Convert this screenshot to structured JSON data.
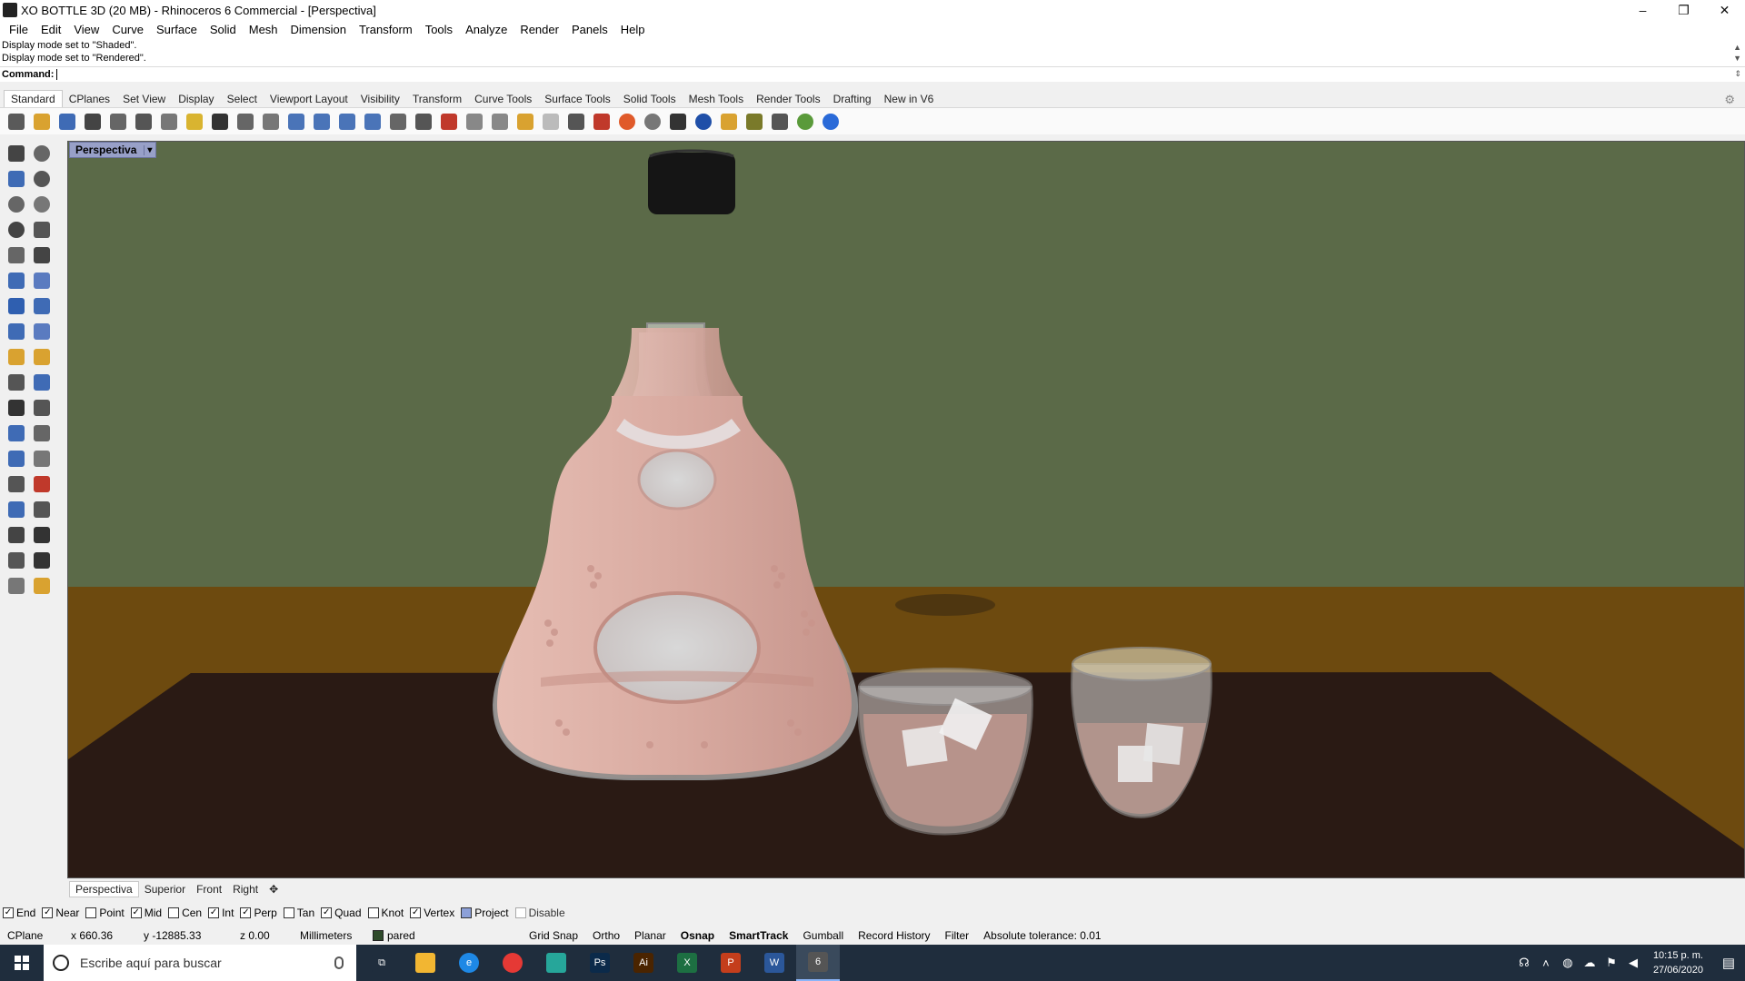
{
  "window": {
    "title": "XO BOTTLE 3D (20 MB) - Rhinoceros 6 Commercial - [Perspectiva]",
    "minimize": "–",
    "restore": "❐",
    "close": "✕"
  },
  "menu": [
    "File",
    "Edit",
    "View",
    "Curve",
    "Surface",
    "Solid",
    "Mesh",
    "Dimension",
    "Transform",
    "Tools",
    "Analyze",
    "Render",
    "Panels",
    "Help"
  ],
  "command_history": [
    "Display mode set to \"Shaded\".",
    "Display mode set to \"Rendered\"."
  ],
  "command_prompt": "Command:",
  "toolbar_tabs": [
    "Standard",
    "CPlanes",
    "Set View",
    "Display",
    "Select",
    "Viewport Layout",
    "Visibility",
    "Transform",
    "Curve Tools",
    "Surface Tools",
    "Solid Tools",
    "Mesh Tools",
    "Render Tools",
    "Drafting",
    "New in V6"
  ],
  "active_toolbar_tab": "Standard",
  "toolbar_icons": [
    "new-file-icon",
    "open-icon",
    "save-icon",
    "print-icon",
    "import-icon",
    "cut-icon",
    "copy-icon",
    "paste-icon",
    "undo-icon",
    "pan-icon",
    "move-view-icon",
    "zoom-icon",
    "zoom-window-icon",
    "zoom-extents-icon",
    "zoom-selected-icon",
    "rotate-view-icon",
    "four-view-icon",
    "car-icon",
    "hide-icon",
    "show-icon",
    "points-icon",
    "light-icon",
    "lock-icon",
    "shield-icon",
    "color-wheel-icon",
    "sphere-icon",
    "material-icon",
    "render-sphere-icon",
    "flashlight-icon",
    "settings-gears-icon",
    "transform-icon",
    "globe-icon",
    "help-icon"
  ],
  "sidebar_icons": [
    "select-arrow-icon",
    "point-icon",
    "polyline-icon",
    "control-point-curve-icon",
    "circle-icon",
    "ellipse-icon",
    "arc-icon",
    "rectangle-icon",
    "polygon-icon",
    "fillet-curve-icon",
    "surface-icon",
    "cap-icon",
    "box-icon",
    "boolean-icon",
    "extrude-icon",
    "loft-icon",
    "offset-icon",
    "pipe-icon",
    "trim-icon",
    "split-icon",
    "join-icon",
    "group-icon",
    "move-icon",
    "rotate-icon",
    "text-icon",
    "dimension-icon",
    "array-icon",
    "mirror-icon",
    "solid-tools-icon",
    "layout-icon",
    "grid-icon",
    "mesh-icon",
    "analyze-icon",
    "check-icon",
    "render-icon",
    "bucket-icon"
  ],
  "viewport": {
    "title": "Perspectiva",
    "menu_arrow": "▾",
    "colors": {
      "wall": "#5a6a47",
      "table_wood": "#6e4a10",
      "tabletop": "#2a1a13",
      "liquid": "#d4a59a",
      "glass": "#d9d9d9",
      "cap": "#141414"
    }
  },
  "viewport_tabs": [
    "Perspectiva",
    "Superior",
    "Front",
    "Right"
  ],
  "viewport_add": "✥",
  "osnap": [
    {
      "label": "End",
      "checked": true
    },
    {
      "label": "Near",
      "checked": true
    },
    {
      "label": "Point",
      "checked": false
    },
    {
      "label": "Mid",
      "checked": true
    },
    {
      "label": "Cen",
      "checked": false
    },
    {
      "label": "Int",
      "checked": true
    },
    {
      "label": "Perp",
      "checked": true
    },
    {
      "label": "Tan",
      "checked": false
    },
    {
      "label": "Quad",
      "checked": true
    },
    {
      "label": "Knot",
      "checked": false
    },
    {
      "label": "Vertex",
      "checked": true
    }
  ],
  "osnap_project": "Project",
  "osnap_disable": "Disable",
  "status": {
    "cplane": "CPlane",
    "x": "x 660.36",
    "y": "y -12885.33",
    "z": "z 0.00",
    "units": "Millimeters",
    "layer": "pared",
    "grid_snap": "Grid Snap",
    "ortho": "Ortho",
    "planar": "Planar",
    "osnap": "Osnap",
    "smarttrack": "SmartTrack",
    "gumball": "Gumball",
    "record_history": "Record History",
    "filter": "Filter",
    "tolerance": "Absolute tolerance: 0.01"
  },
  "taskbar": {
    "search_placeholder": "Escribe aquí para buscar",
    "apps": [
      {
        "name": "task-view-icon",
        "label": "⧉",
        "color": "#1f2d3d"
      },
      {
        "name": "file-explorer-icon",
        "label": "",
        "color": "#f2b632"
      },
      {
        "name": "edge-icon",
        "label": "e",
        "color": "#1e88e5"
      },
      {
        "name": "chrome-icon",
        "label": "",
        "color": "#e53935"
      },
      {
        "name": "app-icon",
        "label": "",
        "color": "#26a69a"
      },
      {
        "name": "photoshop-icon",
        "label": "Ps",
        "color": "#0b2a4a"
      },
      {
        "name": "illustrator-icon",
        "label": "Ai",
        "color": "#4a2400"
      },
      {
        "name": "excel-icon",
        "label": "X",
        "color": "#1d6f42"
      },
      {
        "name": "powerpoint-icon",
        "label": "P",
        "color": "#c43e1c"
      },
      {
        "name": "word-icon",
        "label": "W",
        "color": "#2b579a"
      },
      {
        "name": "rhino-icon",
        "label": "6",
        "color": "#555555"
      }
    ],
    "time": "10:15 p. m.",
    "date": "27/06/2020"
  }
}
